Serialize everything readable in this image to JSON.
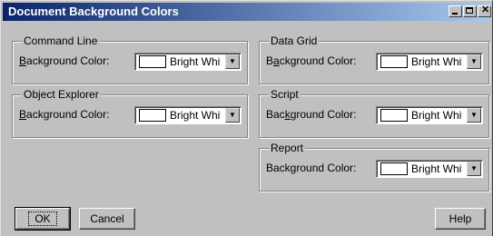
{
  "window": {
    "title": "Document Background Colors"
  },
  "groups": {
    "command_line": {
      "title": "Command Line",
      "label_pre": "",
      "label_key": "B",
      "label_post": "ackground Color:",
      "value": "Bright White"
    },
    "object_explorer": {
      "title": "Object Explorer",
      "label_pre": "",
      "label_key": "B",
      "label_post": "ackground Color:",
      "value": "Bright White"
    },
    "data_grid": {
      "title": "Data Grid",
      "label_pre": "B",
      "label_key": "a",
      "label_post": "ckground Color:",
      "value": "Bright White"
    },
    "script": {
      "title": "Script",
      "label_pre": "Bac",
      "label_key": "k",
      "label_post": "ground Color:",
      "value": "Bright White"
    },
    "report": {
      "title": "Report",
      "label_pre": "",
      "label_key": "",
      "label_post": "Background Color:",
      "value": "Bright White"
    }
  },
  "buttons": {
    "ok": "OK",
    "cancel": "Cancel",
    "help": "Help"
  },
  "icons": {
    "minimize": "minimize-icon",
    "maximize": "maximize-icon",
    "close": "close-icon",
    "dropdown": "chevron-down-icon"
  }
}
